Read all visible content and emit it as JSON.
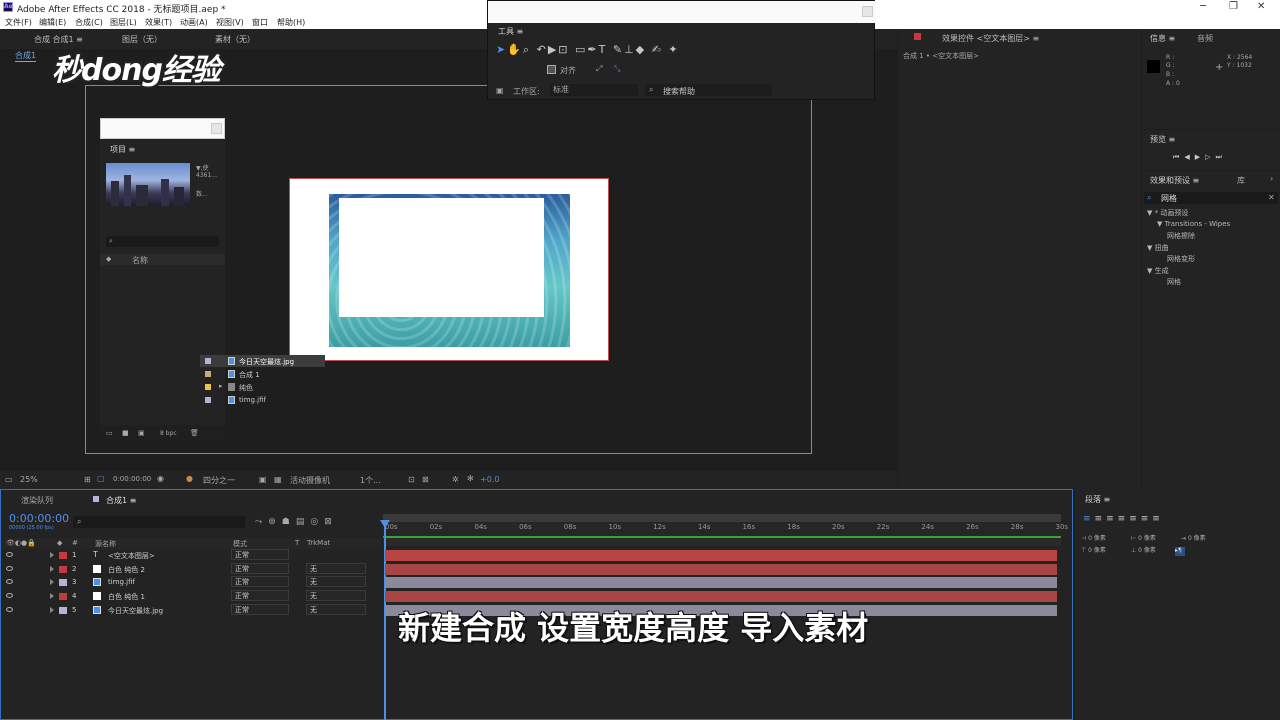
{
  "window": {
    "title": "Adobe After Effects CC 2018 - 无标题项目.aep *",
    "app_badge": "Ae"
  },
  "menu": [
    "文件(F)",
    "编辑(E)",
    "合成(C)",
    "图层(L)",
    "效果(T)",
    "动画(A)",
    "视图(V)",
    "窗口",
    "帮助(H)"
  ],
  "watermark": "秒dong经验",
  "caption": "新建合成 设置宽度高度 导入素材",
  "comp_panel": {
    "tabs": [
      "合成 合成1 ≡",
      "图层（无）",
      "素材（无）"
    ],
    "subtab": "合成1"
  },
  "tools_panel": {
    "title": "工具 ≡",
    "align_label": "对齐",
    "workspace_label": "工作区:",
    "workspace_value": "标准",
    "search_placeholder": "搜索帮助"
  },
  "project_panel": {
    "title": "项目 ≡",
    "info_line1": "▼,使",
    "info_line2": "4361...",
    "info_line3": "数...",
    "col_name": "名称",
    "bpc": "8 bpc",
    "items": [
      {
        "name": "今日天空最炫.jpg",
        "color": "#b4b4d8",
        "selected": true
      },
      {
        "name": "合成 1",
        "color": "#c8a878"
      },
      {
        "name": "纯色",
        "color": "#e8c84a",
        "folder": true
      },
      {
        "name": "timg.jfif",
        "color": "#b4b4d8"
      }
    ]
  },
  "viewer_controls": {
    "zoom": "25%",
    "time": "0:00:00:00",
    "resolution": "四分之一",
    "camera": "活动摄像机",
    "views": "1个...",
    "offset": "+0.0"
  },
  "effect_controls": {
    "title": "效果控件 <空文本图层> ≡",
    "subtitle": "合成 1 • <空文本图层>"
  },
  "info_panel": {
    "tab1": "信息 ≡",
    "tab2": "音频",
    "r": "R :",
    "g": "G :",
    "b": "B :",
    "a": "A : 0",
    "x": "X : 2564",
    "y": "Y : 1032"
  },
  "preview_panel": {
    "title": "预览 ≡"
  },
  "effects_presets": {
    "title": "效果和预设 ≡",
    "tab2": "库",
    "search": "网格",
    "tree": [
      {
        "label": "▼ * 动画预设",
        "indent": 0
      },
      {
        "label": "▼ Transitions - Wipes",
        "indent": 1
      },
      {
        "label": "网格擦除",
        "indent": 2
      },
      {
        "label": "▼ 扭曲",
        "indent": 0
      },
      {
        "label": "网格变形",
        "indent": 2
      },
      {
        "label": "▼ 生成",
        "indent": 0
      },
      {
        "label": "网格",
        "indent": 2
      }
    ]
  },
  "paragraph_panel": {
    "title": "段落 ≡",
    "f1": "0 像素",
    "f2": "0 像素",
    "f3": "0 像素",
    "f4": "0 像素",
    "f5": "0 像素"
  },
  "timeline": {
    "tabs": [
      "渲染队列",
      "合成1 ≡"
    ],
    "timecode": "0:00:00:00",
    "fps": "00000 (25.00 fps)",
    "headers": {
      "num": "#",
      "name": "源名称",
      "mode": "模式",
      "t": "T",
      "trk": "TrkMat"
    },
    "layers": [
      {
        "num": "1",
        "name": "<空文本图层>",
        "mode": "正常",
        "trk": "",
        "color": "#c83a3a",
        "bar": "#b84444",
        "type": "text"
      },
      {
        "num": "2",
        "name": "白色 纯色 2",
        "mode": "正常",
        "trk": "无",
        "color": "#c83a3a",
        "bar": "#a84545",
        "type": "solid"
      },
      {
        "num": "3",
        "name": "timg.jfif",
        "mode": "正常",
        "trk": "无",
        "color": "#b4b4d8",
        "bar": "#8a8a9c",
        "type": "image"
      },
      {
        "num": "4",
        "name": "白色 纯色 1",
        "mode": "正常",
        "trk": "无",
        "color": "#c83a3a",
        "bar": "#a84545",
        "type": "solid"
      },
      {
        "num": "5",
        "name": "今日天空最炫.jpg",
        "mode": "正常",
        "trk": "无",
        "color": "#b4b4d8",
        "bar": "#8a8a9c",
        "type": "image"
      }
    ],
    "ticks": [
      "00s",
      "02s",
      "04s",
      "06s",
      "08s",
      "10s",
      "12s",
      "14s",
      "16s",
      "18s",
      "20s",
      "22s",
      "24s",
      "26s",
      "28s",
      "30s"
    ]
  }
}
